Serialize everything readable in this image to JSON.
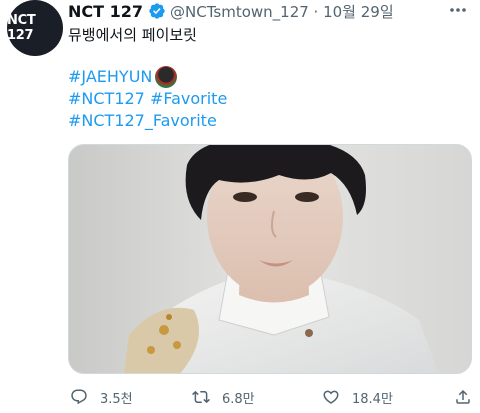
{
  "tweet": {
    "avatar_text": "NCT 127",
    "author_name": "NCT 127",
    "handle_time": "@NCTsmtown_127 · 10월 29일",
    "text": "뮤뱅에서의 페이보릿",
    "hashtags": [
      "#JAEHYUN",
      "#NCT127 #Favorite",
      "#NCT127_Favorite"
    ]
  },
  "actions": {
    "replies": "3.5천",
    "retweets": "6.8만",
    "likes": "18.4만"
  },
  "colors": {
    "link": "#1d9bf0",
    "muted": "#536471",
    "verified": "#1d9bf0"
  }
}
